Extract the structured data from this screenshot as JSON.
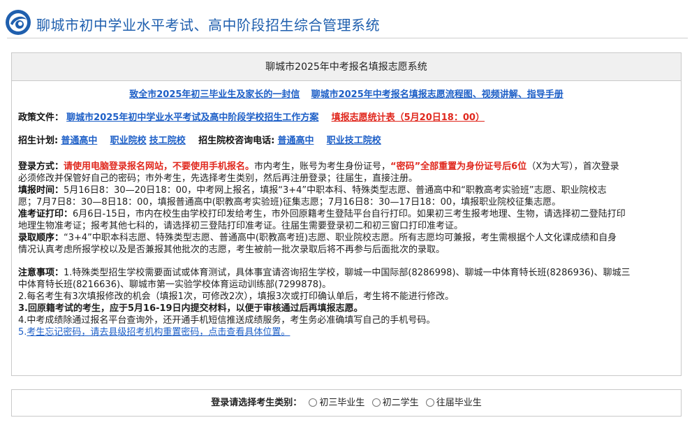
{
  "header": {
    "title": "聊城市初中学业水平考试、高中阶段招生综合管理系统",
    "logo_icon": "globe-logo-icon",
    "logo_color": "#1f5fae"
  },
  "panel": {
    "title": "聊城市2025年中考报名填报志愿系统",
    "top_links": [
      "致全市2025年初三毕业生及家长的一封信",
      "聊城市2025年中考报名填报志愿流程图、视频讲解、指导手册"
    ],
    "policy_label": "政策文件：",
    "policy_link": "聊城市2025年初中学业水平考试及高中阶段学校招生工作方案",
    "policy_red_link": "填报志愿统计表（5月20日18：00）",
    "plan_label": "招生计划:",
    "plan_links": [
      "普通高中",
      "职业院校",
      "技工院校"
    ],
    "consult_label": "招生院校咨询电话:",
    "consult_links": [
      "普通高中",
      "职业技工院校"
    ],
    "login_label": "登录方式：",
    "login_red1": "请使用电脑登录报名网站，不要使用手机报名。",
    "login_text1": "市内考生，账号为考生身份证号，",
    "login_red2": "“密码”全部重置为身份证号后6位",
    "login_text2": "（X为大写），首次登录",
    "login_text3": "必须修改并保管好自己的密码；市外考生，先选择考生类别，然后再注册登录；往届生，直接注册。",
    "fill_label": "填报时间：",
    "fill_text1": "5月16日8：30—20日18：00，中考网上报名，填报“3+4”中职本科、特殊类型志愿、普通高中和“职教高考实验班”志愿、职业院校志",
    "fill_text2": "愿；7月7日8：30—8日18：00，填报普通高中(职教高考实验班)征集志愿；7月16日8：30—17日18：00，填报职业院校征集志愿。",
    "admit_label": "准考证打印：",
    "admit_text1": "6月6日-15日，市内在校生由学校打印发给考生，市外回原籍考生登陆平台自行打印。如果初三考生报考地理、生物，请选择初二登陆打印",
    "admit_text2": "地理生物准考证；报考其他七科的，请选择初三登陆打印准考证。往届生需要登录初二和初三窗口打印准考证。",
    "order_label": "录取顺序：",
    "order_text1": "“3+4”中职本科志愿、特殊类型志愿、普通高中(职教高考班)志愿、职业院校志愿。所有志愿均可兼报，考生需根据个人文化课成绩和自身",
    "order_text2": "情况认真考虑所报学校以及是否兼报其他批次的志愿，考生被前一批次录取后将不再参与后面批次的录取。",
    "notes_label": "注意事项：",
    "note1a": "1.特殊类型招生学校需要面试或体育测试，具体事宜请咨询招生学校，聊城一中国际部(8286998)、聊城一中体育特长班(8286936)、聊城三",
    "note1b": "中体育特长班(8216636)、聊城市第一实验学校体育运动训练部(7299878)。",
    "note2": "2.每名考生有3次填报修改的机会（填报1次，可修改2次），填报3次或打印确认单后，考生将不能进行修改。",
    "note3": "3.回原籍考试的考生，应于5月16-19日内提交材料，以便于审核通过后再填报志愿。",
    "note4": "4.中考成绩除通过报名平台查询外，还开通手机短信推送成绩服务，考生务必准确填写自己的手机号码。",
    "note5_prefix": "5.",
    "note5_link": "考生忘记密码，请去县级招考机构重置密码，点击查看具体位置。"
  },
  "login": {
    "label": "登录请选择考生类别：",
    "options": [
      "初三毕业生",
      "初二学生",
      "往届毕业生"
    ]
  },
  "colors": {
    "link": "#1d5fc7",
    "red": "#e0281e",
    "title_blue": "#1f5fae"
  }
}
